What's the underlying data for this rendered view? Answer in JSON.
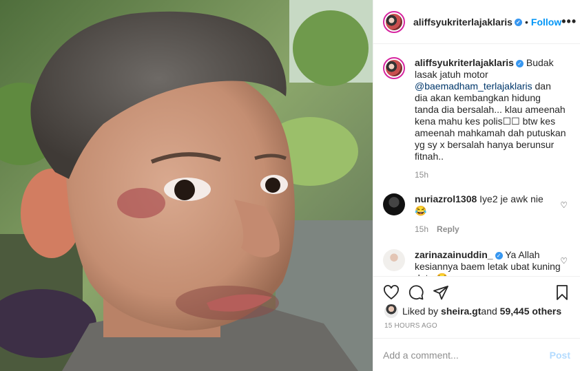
{
  "post": {
    "username": "aliffsyukriterlajaklaris",
    "follow_label": "Follow",
    "more_label": "•••",
    "verified_glyph": "✓",
    "dot": "•"
  },
  "caption": {
    "username": "aliffsyukriterlajaklaris",
    "text_before": "Budak lasak jatuh motor ",
    "mention": "@baemadham_terlajaklaris",
    "text_after": " dan dia akan kembangkan hidung tanda dia bersalah... klau ameenah kena mahu kes polis☐☐ btw kes ameenah mahkamah dah putuskan yg sy x bersalah hanya berunsur fitnah..",
    "time": "15h"
  },
  "comments": [
    {
      "username": "nuriazrol1308",
      "text": "Iye2 je awk nie",
      "emoji": "😂",
      "time": "15h",
      "reply": "Reply"
    },
    {
      "username": "zarinazainuddin_",
      "text": "Ya Allah kesiannya baem letak ubat kuning dato",
      "emoji": "😭"
    }
  ],
  "icons": {
    "heart": "heart-icon",
    "comment": "comment-icon",
    "share": "share-icon",
    "save": "bookmark-icon"
  },
  "likes": {
    "prefix": "Liked by ",
    "user": "sheira.gt",
    "middle": " and ",
    "count": "59,445 others"
  },
  "timestamp": "15 HOURS AGO",
  "add_comment": {
    "placeholder": "Add a comment...",
    "post_label": "Post"
  },
  "colors": {
    "accent": "#0095f6",
    "verified": "#3897f0",
    "muted": "#8e8e8e",
    "post_disabled": "#b3dbff"
  }
}
